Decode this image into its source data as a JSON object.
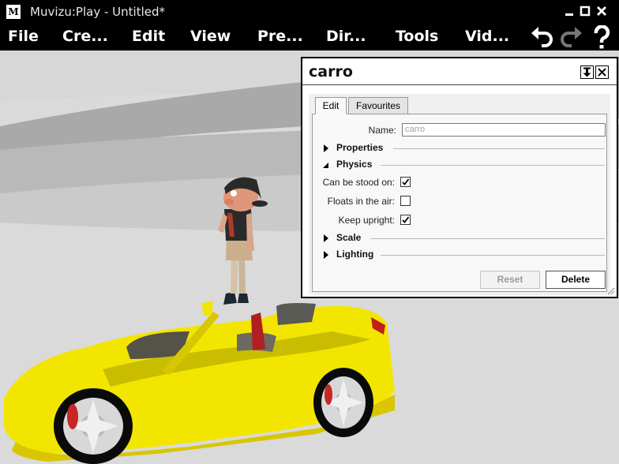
{
  "window": {
    "logo": "M",
    "title": "Muvizu:Play - Untitled*",
    "icons": [
      "minimize-icon",
      "maximize-icon",
      "close-icon"
    ]
  },
  "menu": {
    "items": [
      "File",
      "Cre...",
      "Edit",
      "View",
      "Pre...",
      "Dir...",
      "Tools",
      "Vid..."
    ],
    "tools": [
      "undo-icon",
      "redo-icon",
      "help-icon"
    ]
  },
  "panel": {
    "title": "carro",
    "icons": [
      "pin-icon",
      "close-icon"
    ],
    "tabs": [
      "Edit",
      "Favourites"
    ],
    "active_tab": "Edit",
    "name_label": "Name:",
    "name_value": "carro",
    "sections": {
      "properties": "Properties",
      "physics": "Physics",
      "scale": "Scale",
      "lighting": "Lighting"
    },
    "physics_options": [
      {
        "label": "Can be stood on:",
        "checked": true
      },
      {
        "label": "Floats in the air:",
        "checked": false
      },
      {
        "label": "Keep upright:",
        "checked": true
      }
    ],
    "reset_label": "Reset",
    "delete_label": "Delete"
  },
  "colors": {
    "chrome": "#000000",
    "car_body": "#f2e600",
    "sky": "#d4d4d4"
  }
}
